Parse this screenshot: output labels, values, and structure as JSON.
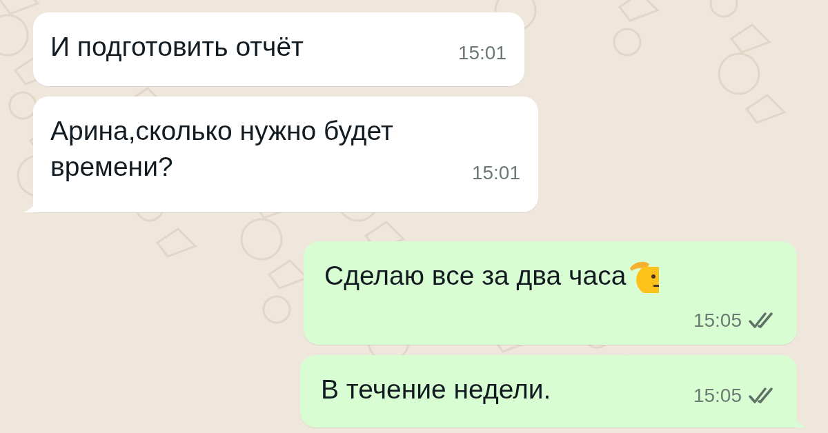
{
  "messages": [
    {
      "kind": "incoming",
      "text": "И подготовить отчёт",
      "time": "15:01",
      "tail": false
    },
    {
      "kind": "incoming",
      "text": "Арина,сколько нужно будет времени?",
      "time": "15:01",
      "tail": true
    },
    {
      "kind": "outgoing",
      "text": "Сделаю все за два часа",
      "saluting_emoji": true,
      "time": "15:05",
      "read": false,
      "tail": false
    },
    {
      "kind": "outgoing",
      "text": "В течение недели.",
      "time": "15:05",
      "read": false,
      "tail": true
    }
  ]
}
